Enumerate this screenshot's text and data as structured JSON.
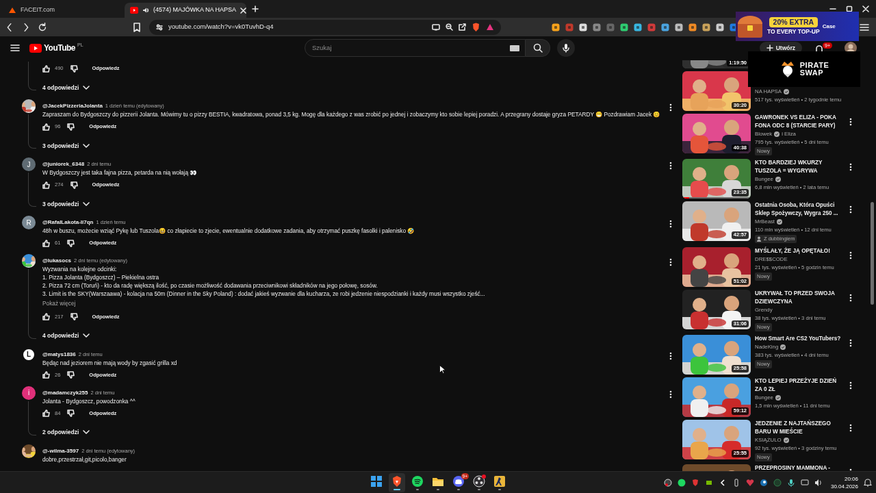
{
  "browser": {
    "tabs": [
      {
        "title": "FACEIT.com",
        "selected": false,
        "audio": false
      },
      {
        "title": "(4574) MAJÓWKA NA HAPSA",
        "selected": true,
        "audio": true
      }
    ],
    "url": "youtube.com/watch?v=vk0TuvhD-q4"
  },
  "youtube": {
    "logo": "YouTube",
    "region": "PL",
    "search_placeholder": "Szukaj",
    "create": "Utwórz",
    "notifications": "9+"
  },
  "comments": [
    {
      "likes": "490",
      "reply": "Odpowiedz",
      "replies": "4 odpowiedzi"
    },
    {
      "author": "@JacekPizzeriaJolanta",
      "meta": "1 dzień temu (edytowany)",
      "avatar": {
        "kind": "picture"
      },
      "lines": [
        "Zapraszam do Bydgoszczy do pizzerii Jolanta. Mówimy tu o pizzy BESTIA, kwadratowa, ponad 3,5 kg. Mogę dla każdego z was zrobić po jednej i zobaczymy kto sobie lepiej poradzi. A przegrany dostaje gryza PETARDY 😁 Pozdrawiam Jacek 😊"
      ],
      "likes": "96",
      "reply": "Odpowiedz",
      "replies": "3 odpowiedzi"
    },
    {
      "author": "@juniorek_6348",
      "meta": "2 dni temu",
      "avatar": {
        "kind": "letter",
        "letter": "J",
        "color": "#5f6b73"
      },
      "lines": [
        "W Bydgoszczy jest taka fajna pizza, petarda na nią wołają 👀"
      ],
      "likes": "274",
      "reply": "Odpowiedz",
      "replies": "3 odpowiedzi"
    },
    {
      "author": "@RafalLakota-li7qn",
      "meta": "1 dzień temu",
      "avatar": {
        "kind": "letter",
        "letter": "R",
        "color": "#7b8a95"
      },
      "lines": [
        "48h w buszu, możecie wziąć Pykę lub Tuszola😆 co złapiecie to zjecie, ewentualnie dodatkowe zadania, aby otrzymać puszkę fasolki i palenisko 🤣"
      ],
      "likes": "61",
      "reply": "Odpowiedz"
    },
    {
      "author": "@lukasocs",
      "meta": "2 dni temu (edytowany)",
      "avatar": {
        "kind": "picture"
      },
      "lines": [
        "Wyzwania na kolejne odcinki:",
        "1. Pizza Jolanta (Bydgoszcz) – Piekielna ostra",
        "2. Pizza 72 cm (Toruń) - kto da radę większą ilość, po czasie możliwość dodawania przeciwnikowi składników na jego połowę, sosów.",
        "3. Limit is the SKY(Warszaawa) - kolacja na 50m (Dinner in the Sky Poland) : dodać jakieś wyzwanie dla kucharza, ze robi jedzenie niespodzianki i każdy musi wszystko zjeść..."
      ],
      "more": "Pokaż więcej",
      "likes": "217",
      "reply": "Odpowiedz",
      "replies": "4 odpowiedzi"
    },
    {
      "author": "@matys1836",
      "meta": "2 dni temu",
      "avatar": {
        "kind": "letter",
        "letter": "L",
        "color": "#ffffff"
      },
      "lines": [
        "Będąc nad jeziorem nie mają wody by zgasić grilla xd"
      ],
      "likes": "26",
      "reply": "Odpowiedz"
    },
    {
      "author": "@madamczyk255",
      "meta": "2 dni temu",
      "avatar": {
        "kind": "letter",
        "letter": "i",
        "color": "#e0307a"
      },
      "lines": [
        "Jolanta - Bydgoszcz, powodzonka ^^"
      ],
      "likes": "84",
      "reply": "Odpowiedz",
      "replies": "2 odpowiedzi"
    },
    {
      "author": "@-wilma-3597",
      "meta": "2 dni temu (edytowany)",
      "avatar": {
        "kind": "picture"
      },
      "lines": [
        "dobre,przestrzał,git,picolo,banger"
      ]
    }
  ],
  "videos": [
    {
      "kind": "cut",
      "duration": "1:19:50"
    },
    {
      "kind": "full",
      "duration": "30:20",
      "channel": "NA HAPSA",
      "verified": true,
      "meta": "517 tys. wyświetleń • 2 tygodnie temu"
    },
    {
      "kind": "full",
      "duration": "40:38",
      "title": "GAWRONEK VS ELIZA - POKA FONA ODC 8 (STARCIE PARY)",
      "channel": "Blowek",
      "verified": true,
      "coauthor": "i Eliza",
      "meta": "795 tys. wyświetleń • 5 dni temu",
      "badge": {
        "kind": "new",
        "label": "Nowy"
      }
    },
    {
      "kind": "full",
      "duration": "23:35",
      "title": "KTO BARDZIEJ WKURZY TUSZOLA = WYGRYWA",
      "channel": "Bungee",
      "verified": true,
      "meta": "6,8 mln wyświetleń • 2 lata temu",
      "level": 0.1
    },
    {
      "kind": "full",
      "duration": "42:57",
      "title": "Ostatnia Osoba, Która Opuści Sklep Spożywczy, Wygra 250 ...",
      "channel": "MrBeast",
      "verified": true,
      "meta": "110 mln wyświetleń • 12 dni temu",
      "badge": {
        "kind": "dub",
        "label": "Z dubbingiem"
      }
    },
    {
      "kind": "full",
      "duration": "51:02",
      "title": "MYŚLAŁY, ŻE JĄ OPĘTAŁO!",
      "channel": "DRE$$CODE",
      "verified": false,
      "meta": "21 tys. wyświetleń • 5 godzin temu",
      "badge": {
        "kind": "new",
        "label": "Nowy"
      }
    },
    {
      "kind": "full",
      "duration": "31:06",
      "title": "UKRYWAŁ TO PRZED SWOJA DZIEWCZYNA",
      "channel": "Grendy",
      "verified": false,
      "meta": "38 tys. wyświetleń • 3 dni temu",
      "badge": {
        "kind": "new",
        "label": "Nowy"
      }
    },
    {
      "kind": "full",
      "duration": "25:58",
      "title": "How Smart Are CS2 YouTubers?",
      "channel": "NadeKing",
      "verified": true,
      "meta": "383 tys. wyświetleń • 4 dni temu",
      "badge": {
        "kind": "new",
        "label": "Nowy"
      }
    },
    {
      "kind": "full",
      "duration": "59:12",
      "title": "KTO LEPIEJ PRZEŻYJE DZIEŃ ZA 0 ZŁ",
      "channel": "Bungee",
      "verified": true,
      "meta": "1,5 mln wyświetleń • 11 dni temu"
    },
    {
      "kind": "full",
      "duration": "25:55",
      "title": "JEDZENIE Z NAJTAŃSZEGO BARU W MIEŚCIE",
      "channel": "KSIĄŻULO",
      "verified": true,
      "meta": "92 tys. wyświetleń • 3 godziny temu",
      "badge": {
        "kind": "new",
        "label": "Nowy"
      }
    },
    {
      "kind": "full",
      "title": "PRZEPROSINY MAMMONA -"
    }
  ],
  "ads": [
    {
      "kind": "chest",
      "lines": [
        "20% EXTRA",
        "TO EVERY TOP-UP",
        "Case"
      ]
    },
    {
      "kind": "pirate",
      "lines": [
        "PIRATE",
        "SWAP"
      ]
    }
  ],
  "taskbar": {
    "apps": [
      {
        "kind": "start",
        "running": false,
        "active": false
      },
      {
        "kind": "brave",
        "running": true,
        "active": true
      },
      {
        "kind": "spotify",
        "running": true,
        "active": false
      },
      {
        "kind": "files",
        "running": true,
        "active": false
      },
      {
        "kind": "discord",
        "running": true,
        "active": false,
        "badge": "9+"
      },
      {
        "kind": "obs",
        "running": true,
        "active": false,
        "alert": true
      },
      {
        "kind": "game",
        "running": true,
        "active": false
      }
    ],
    "time": "20:06",
    "date": "30.04.2026"
  }
}
